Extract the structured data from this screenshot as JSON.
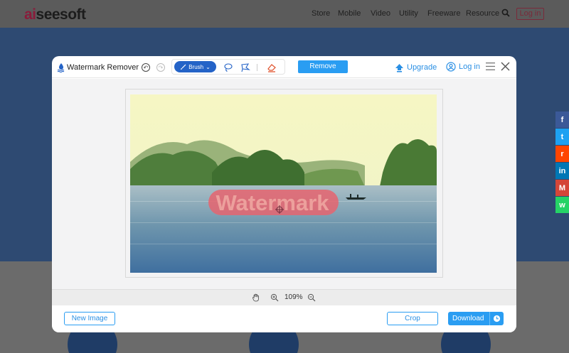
{
  "site": {
    "logo_prefix": "ai",
    "logo_rest": "seesoft",
    "nav": [
      "Store",
      "Mobile",
      "Video",
      "Utility",
      "Freeware",
      "Resource"
    ],
    "login_label": "Log in"
  },
  "share": [
    {
      "icon": "facebook-icon",
      "glyph": "f",
      "color": "#3b5998"
    },
    {
      "icon": "twitter-icon",
      "glyph": "t",
      "color": "#1da1f2"
    },
    {
      "icon": "reddit-icon",
      "glyph": "r",
      "color": "#ff4500"
    },
    {
      "icon": "linkedin-icon",
      "glyph": "in",
      "color": "#0077b5"
    },
    {
      "icon": "gmail-icon",
      "glyph": "M",
      "color": "#d44638"
    },
    {
      "icon": "whatsapp-icon",
      "glyph": "w",
      "color": "#25d366"
    }
  ],
  "modal": {
    "title": "Watermark Remover",
    "brush_label": "Brush",
    "remove_label": "Remove",
    "upgrade_label": "Upgrade",
    "login_label": "Log in",
    "watermark_text": "Watermark",
    "zoom_level": "109%",
    "new_image_label": "New Image",
    "crop_label": "Crop",
    "download_label": "Download"
  },
  "colors": {
    "accent": "#2a9df2",
    "brush_active": "#2463c7",
    "mask": "#e6646e"
  }
}
